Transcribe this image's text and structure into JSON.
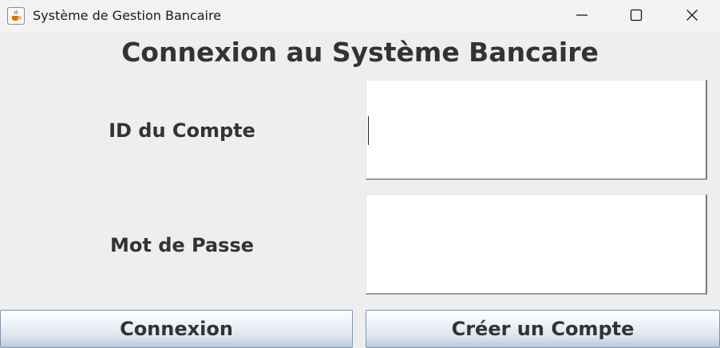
{
  "window": {
    "title": "Système de Gestion Bancaire",
    "app_icon": "java-cup-icon",
    "controls": [
      "minimize-icon",
      "maximize-icon",
      "close-icon"
    ]
  },
  "header": {
    "title": "Connexion au Système Bancaire"
  },
  "form": {
    "account_id": {
      "label": "ID du Compte",
      "value": "",
      "placeholder": ""
    },
    "password": {
      "label": "Mot de Passe",
      "value": "",
      "placeholder": ""
    }
  },
  "buttons": {
    "login_label": "Connexion",
    "create_label": "Créer un Compte"
  },
  "colors": {
    "background": "#eeeeee",
    "text": "#333333",
    "field_background": "#ffffff",
    "button_border": "#7f95ad"
  }
}
